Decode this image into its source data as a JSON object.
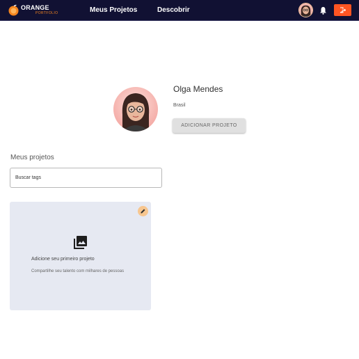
{
  "navbar": {
    "logo_text": "ORANGE",
    "logo_subtext": "PORTFOLIO",
    "links": [
      "Meus Projetos",
      "Descobrir"
    ]
  },
  "profile": {
    "name": "Olga Mendes",
    "country": "Brasil",
    "add_project_label": "ADICIONAR PROJETO"
  },
  "projects": {
    "section_title": "Meus projetos",
    "search_placeholder": "Buscar tags",
    "empty_card": {
      "title": "Adicione seu primeiro projeto",
      "description": "Compartilhe seu talento com milhares de pessoas"
    }
  },
  "icons": {
    "logo": "orange-logo-icon",
    "avatar": "user-avatar",
    "notifications": "bell-icon",
    "logout": "logout-icon",
    "edit": "pencil-icon",
    "empty_state": "image-gallery-icon"
  },
  "colors": {
    "navbar_bg": "#111133",
    "accent_orange": "#ff5522",
    "card_bg": "#e6e9f2",
    "edit_badge": "#f7c68f",
    "button_gray": "#e0e0e0"
  }
}
